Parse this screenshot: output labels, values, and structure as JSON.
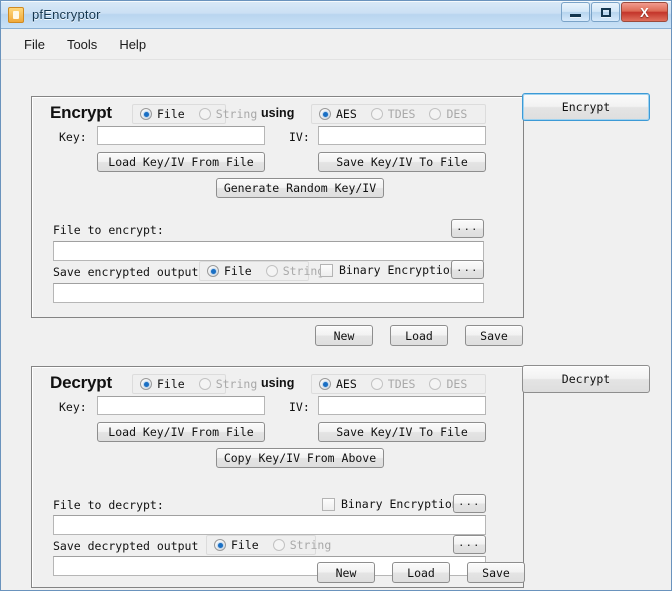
{
  "window": {
    "title": "pfEncryptor",
    "icon": "app-document-icon",
    "caption": {
      "minimize": "minimize-icon",
      "maximize": "maximize-icon",
      "close": "X"
    }
  },
  "menubar": {
    "items": [
      {
        "label": "File"
      },
      {
        "label": "Tools"
      },
      {
        "label": "Help"
      }
    ]
  },
  "encrypt": {
    "heading": "Encrypt",
    "mode_radios": [
      {
        "label": "File",
        "checked": true
      },
      {
        "label": "String",
        "checked": false
      }
    ],
    "using_label": "using",
    "cipher_radios": [
      {
        "label": "AES",
        "checked": true
      },
      {
        "label": "TDES",
        "checked": false
      },
      {
        "label": "DES",
        "checked": false
      }
    ],
    "key_label": "Key:",
    "key_value": "",
    "iv_label": "IV:",
    "iv_value": "",
    "load_key_button": "Load Key/IV From File",
    "save_key_button": "Save Key/IV To File",
    "generate_button": "Generate Random Key/IV",
    "file_label": "File to encrypt:",
    "file_value": "",
    "file_browse_button": "...",
    "output_label": "Save encrypted output to",
    "output_radios": [
      {
        "label": "File",
        "checked": true
      },
      {
        "label": "String",
        "checked": false
      }
    ],
    "binary_checkbox": {
      "label": "Binary Encryption",
      "checked": false
    },
    "output_browse_button": "...",
    "output_value": "",
    "action_button": "Encrypt",
    "footer_buttons": [
      {
        "label": "New"
      },
      {
        "label": "Load"
      },
      {
        "label": "Save"
      }
    ]
  },
  "decrypt": {
    "heading": "Decrypt",
    "mode_radios": [
      {
        "label": "File",
        "checked": true
      },
      {
        "label": "String",
        "checked": false
      }
    ],
    "using_label": "using",
    "cipher_radios": [
      {
        "label": "AES",
        "checked": true
      },
      {
        "label": "TDES",
        "checked": false
      },
      {
        "label": "DES",
        "checked": false
      }
    ],
    "key_label": "Key:",
    "key_value": "",
    "iv_label": "IV:",
    "iv_value": "",
    "load_key_button": "Load Key/IV From File",
    "save_key_button": "Save Key/IV To File",
    "copy_key_button": "Copy Key/IV From Above",
    "file_label": "File to decrypt:",
    "file_value": "",
    "binary_checkbox": {
      "label": "Binary Encryption",
      "checked": false
    },
    "file_browse_button": "...",
    "output_label": "Save decrypted output to",
    "output_radios": [
      {
        "label": "File",
        "checked": true
      },
      {
        "label": "String",
        "checked": false
      }
    ],
    "output_browse_button": "...",
    "output_value": "",
    "action_button": "Decrypt",
    "footer_buttons": [
      {
        "label": "New"
      },
      {
        "label": "Load"
      },
      {
        "label": "Save"
      }
    ]
  },
  "colors": {
    "accent_radio": "#1a6fc4",
    "focus_border": "#3c9ad6",
    "window_bg": "#f0f0f0",
    "close_button": "#c3342a"
  }
}
